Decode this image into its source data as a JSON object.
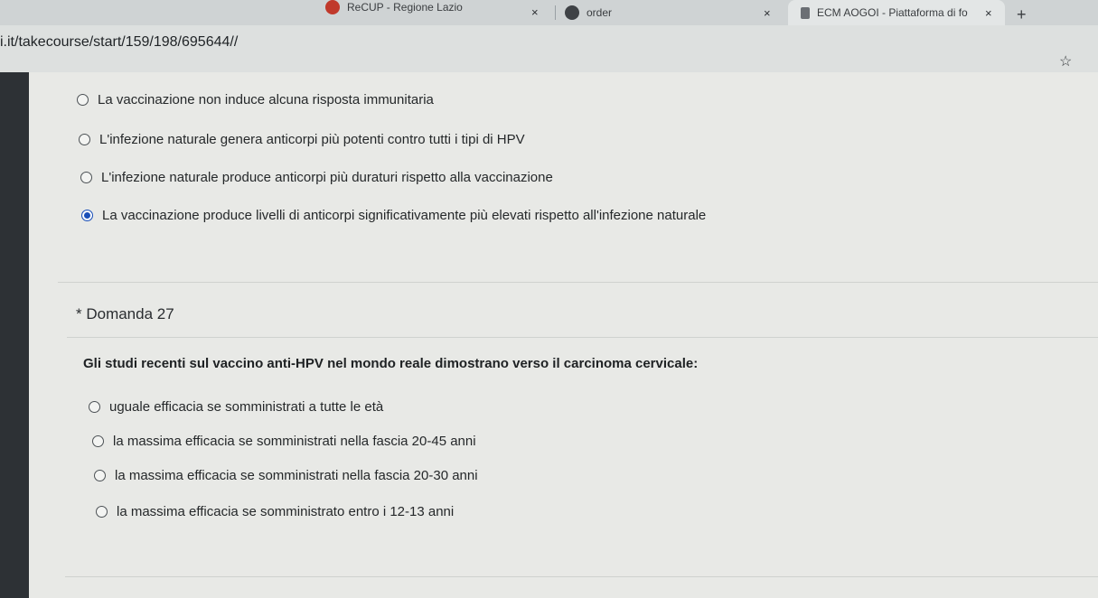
{
  "browser": {
    "tabs": [
      {
        "title": "ReCUP - Regione Lazio",
        "close": "×"
      },
      {
        "title": "order",
        "close": "×"
      },
      {
        "title": "ECM AOGOI - Piattaforma di fo",
        "close": "×",
        "active": true
      }
    ],
    "new_tab": "+",
    "url": "i.it/takecourse/start/159/198/695644//",
    "star": "☆"
  },
  "previous_question": {
    "options": [
      {
        "label": "La vaccinazione non induce alcuna risposta immunitaria",
        "selected": false
      },
      {
        "label": "L'infezione naturale genera anticorpi più potenti contro tutti i tipi di HPV",
        "selected": false
      },
      {
        "label": "L'infezione naturale produce anticorpi più duraturi rispetto alla vaccinazione",
        "selected": false
      },
      {
        "label": "La vaccinazione produce livelli di anticorpi significativamente più elevati rispetto all'infezione naturale",
        "selected": true
      }
    ]
  },
  "question": {
    "title": "* Domanda 27",
    "text": "Gli studi recenti sul vaccino anti-HPV nel mondo reale dimostrano verso il carcinoma cervicale:",
    "options": [
      {
        "label": "uguale efficacia se somministrati a tutte le età",
        "selected": false
      },
      {
        "label": "la massima efficacia se somministrati nella fascia 20-45 anni",
        "selected": false
      },
      {
        "label": "la massima efficacia se somministrati nella fascia 20-30 anni",
        "selected": false
      },
      {
        "label": "la massima efficacia se somministrato entro i 12-13 anni",
        "selected": false
      }
    ]
  },
  "colors": {
    "accent": "#1a4fb8"
  }
}
